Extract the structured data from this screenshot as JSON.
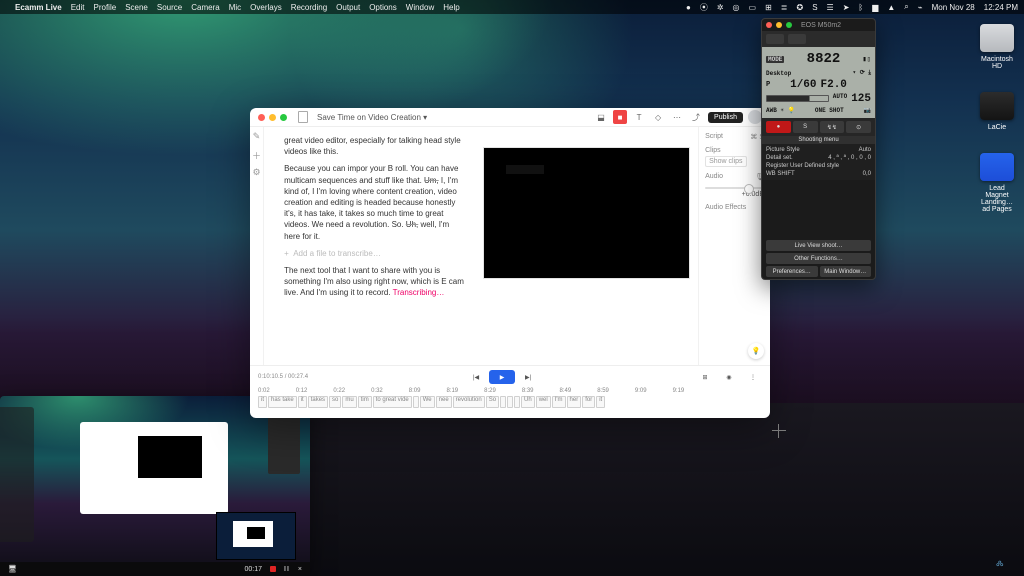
{
  "menubar": {
    "apple": "",
    "app": "Ecamm Live",
    "items": [
      "Edit",
      "Profile",
      "Scene",
      "Source",
      "Camera",
      "Mic",
      "Overlays",
      "Recording",
      "Output",
      "Options",
      "Window",
      "Help"
    ],
    "right": {
      "date": "Mon Nov 28",
      "time": "12:24 PM"
    }
  },
  "desktop_icons": [
    {
      "label": "Macintosh HD",
      "kind": "hd"
    },
    {
      "label": "LaCie",
      "kind": "lacie"
    },
    {
      "label": "Lead Magnet Landing…ad Pages",
      "kind": "pages"
    }
  ],
  "descript": {
    "title": "Save Time on Video Creation  ▾",
    "toolbar": {
      "publish": "Publish",
      "text_tool": "T"
    },
    "editor": {
      "para1": "great video editor, especially for talking head style videos like this.",
      "para2a": "Because you can impor your B roll. You can have multicam sequences and stuff like that. ",
      "strike1": "Um,",
      "para2b": " I, I'm kind of, I I'm loving where content creation, video creation and editing is headed because honestly it's, it has take, it takes so much time to great videos. We need a revolution. So. ",
      "strike2": "Uh,",
      "para2c": " well, I'm here for it.",
      "placeholder": "Add a file to transcribe…",
      "para3": "The next tool that I want to share with you is something I'm also using right now, which is E cam live. And I'm using it to record. ",
      "transcribing": "Transcribing…"
    },
    "sidebar": {
      "script": {
        "label": "Script",
        "hint": "⌘  S"
      },
      "clips": {
        "label": "Clips",
        "hint": "Show clips"
      },
      "audio": {
        "label": "Audio",
        "value": "+0.0dB",
        "mic": "🎙"
      },
      "effects": {
        "label": "Audio Effects"
      }
    },
    "playbar": {
      "current": "0:10:10.5",
      "total": "00:27.4",
      "ticks": [
        "0:02",
        "0:12",
        "0:22",
        "0:32",
        "8:09",
        "8:19",
        "8:29",
        "8:39",
        "8:49",
        "8:59",
        "9:09",
        "9:19"
      ],
      "words": [
        "it",
        "has take",
        "it",
        "takes",
        "so",
        "mu",
        "tim",
        "to great vide",
        "",
        "We",
        "nee",
        "revolution",
        "So",
        "",
        "",
        "",
        "Uh",
        "wel",
        "I'm",
        "her",
        "for",
        "it"
      ]
    }
  },
  "camera": {
    "title": "EOS M50m2",
    "mode": "MODE",
    "shots": "8822",
    "desktop": "Desktop",
    "shutter": "1/60",
    "aperture": "F2.0",
    "iso_label": "AUTO",
    "iso": "125",
    "af": "AF",
    "one": "ONE SHOT",
    "menu_title": "Shooting menu",
    "list": [
      {
        "k": "Picture Style",
        "v": "Auto"
      },
      {
        "k": "Detail set.",
        "v": "4 , ª , ª , 0 , 0 , 0"
      },
      {
        "k": "Register User Defined style",
        "v": ""
      },
      {
        "k": "WB SHIFT",
        "v": "0,0"
      }
    ],
    "footer": {
      "lvs": "Live View shoot…",
      "other": "Other Functions…",
      "prefs": "Preferences…",
      "main": "Main Window…"
    }
  },
  "ecamm": {
    "timer": "00:17"
  }
}
